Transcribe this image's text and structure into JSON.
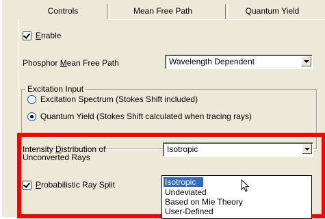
{
  "tabs": [
    {
      "label": "Controls",
      "active": true
    },
    {
      "label": "Mean Free Path",
      "active": false
    },
    {
      "label": "Quantum Yield",
      "active": false
    }
  ],
  "enable": {
    "label": "Enable",
    "checked": true
  },
  "phosphor": {
    "label": "Phosphor Mean Free Path",
    "value": "Wavelength Dependent"
  },
  "excitation": {
    "group_label": "Excitation Input",
    "options": [
      {
        "label": "Excitation Spectrum (Stokes Shift included)",
        "selected": false
      },
      {
        "label": "Quantum Yield (Stokes Shift calculated when tracing rays)",
        "selected": true
      }
    ]
  },
  "intensity": {
    "label_line1": "Intensity Distribution of",
    "label_line2": "Unconverted Rays",
    "value": "Isotropic",
    "dropdown_options": [
      "Isotropic",
      "Undeviated",
      "Based on Mie Theory",
      "User-Defined"
    ],
    "highlighted_index": 0
  },
  "ray_split": {
    "label": "Probabilistic Ray Split",
    "checked": true
  },
  "colors": {
    "highlight_border": "#ff0000",
    "selection": "#316ac5",
    "panel": "#ece9d8"
  }
}
